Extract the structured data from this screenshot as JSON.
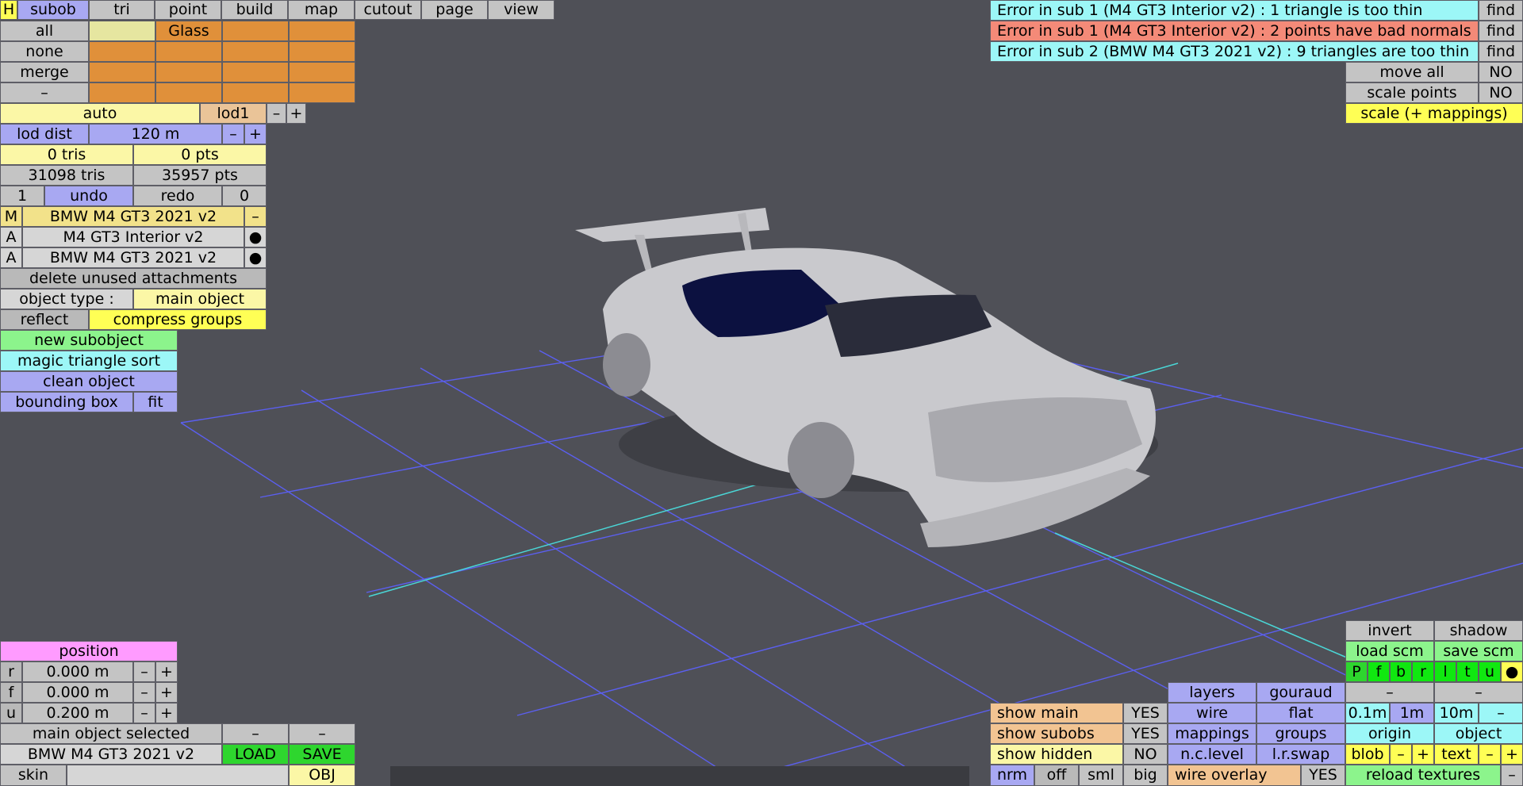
{
  "menu": {
    "h": "H",
    "subob": "subob",
    "tri": "tri",
    "point": "point",
    "build": "build",
    "map": "map",
    "cutout": "cutout",
    "page": "page",
    "view": "view"
  },
  "sel": {
    "all": "all",
    "none": "none",
    "merge": "merge",
    "dash": "–",
    "glass": "Glass"
  },
  "lod": {
    "auto": "auto",
    "lod1": "lod1",
    "minus": "–",
    "plus": "+",
    "dist_label": "lod dist",
    "dist_value": "120 m"
  },
  "stats": {
    "tris_sel": "0 tris",
    "pts_sel": "0 pts",
    "tris_total": "31098 tris",
    "pts_total": "35957 pts"
  },
  "undo": {
    "count": "1",
    "undo": "undo",
    "redo": "redo",
    "redo_count": "0"
  },
  "objects": {
    "main_tag": "M",
    "main_name": "BMW M4 GT3 2021 v2",
    "main_btn": "–",
    "attachments": [
      {
        "tag": "A",
        "name": "M4 GT3 Interior v2",
        "btn": "●"
      },
      {
        "tag": "A",
        "name": "BMW M4 GT3 2021 v2",
        "btn": "●"
      }
    ],
    "delete_unused": "delete unused attachments",
    "type_label": "object type :",
    "type_value": "main object",
    "reflect": "reflect",
    "compress": "compress groups",
    "new_subobject": "new subobject",
    "magic_sort": "magic triangle sort",
    "clean": "clean object",
    "bounding_box": "bounding box",
    "fit": "fit"
  },
  "position": {
    "title": "position",
    "rows": [
      {
        "axis": "r",
        "value": "0.000 m"
      },
      {
        "axis": "f",
        "value": "0.000 m"
      },
      {
        "axis": "u",
        "value": "0.200 m"
      }
    ],
    "minus": "–",
    "plus": "+"
  },
  "file": {
    "selected": "main object selected",
    "dash": "–",
    "name": "BMW M4 GT3 2021 v2",
    "load": "LOAD",
    "save": "SAVE",
    "skin": "skin",
    "obj": "OBJ"
  },
  "errors": [
    {
      "text": "Error in sub 1 (M4 GT3 Interior v2) : 1 triangle is too thin",
      "find": "find"
    },
    {
      "text": "Error in sub 1 (M4 GT3 Interior v2) : 2 points have bad normals",
      "find": "find"
    },
    {
      "text": "Error in sub 2 (BMW M4 GT3 2021 v2) : 9 triangles are too thin",
      "find": "find"
    }
  ],
  "transform": {
    "move_all": "move all",
    "move_val": "NO",
    "scale_points": "scale points",
    "scale_val": "NO",
    "scale_mappings": "scale (+ mappings)"
  },
  "render": {
    "invert": "invert",
    "shadow": "shadow",
    "load_scm": "load scm",
    "save_scm": "save scm",
    "views": [
      "P",
      "f",
      "b",
      "r",
      "l",
      "t",
      "u",
      "●"
    ],
    "layers": "layers",
    "gouraud": "gouraud",
    "dash": "–",
    "show_main": "show main",
    "show_main_val": "YES",
    "show_subobs": "show subobs",
    "show_subobs_val": "YES",
    "show_hidden": "show hidden",
    "show_hidden_val": "NO",
    "wire": "wire",
    "flat": "flat",
    "mappings": "mappings",
    "groups": "groups",
    "nc_level": "n.c.level",
    "lr_swap": "l.r.swap",
    "grid_01": "0.1m",
    "grid_1": "1m",
    "grid_10": "10m",
    "origin": "origin",
    "object": "object",
    "blob": "blob",
    "text": "text",
    "minus": "–",
    "plus": "+",
    "nrm": "nrm",
    "off": "off",
    "sml": "sml",
    "big": "big",
    "wire_overlay": "wire overlay",
    "wire_overlay_val": "YES",
    "reload": "reload textures"
  }
}
